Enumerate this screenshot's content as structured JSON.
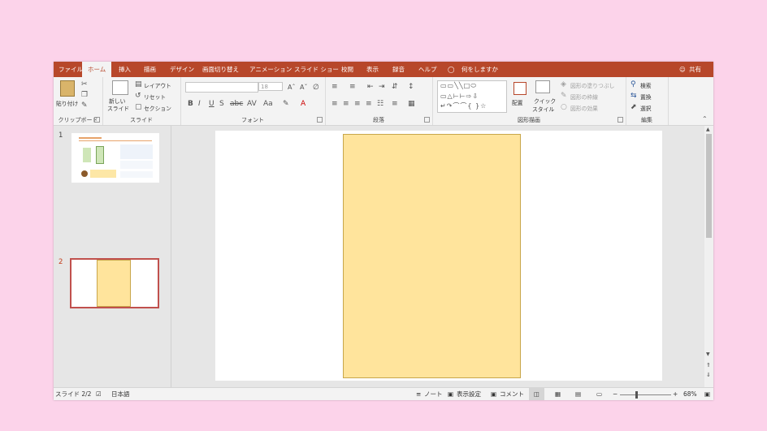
{
  "tabs": [
    "ファイル",
    "ホーム",
    "挿入",
    "描画",
    "デザイン",
    "画面切り替え",
    "アニメーション",
    "スライド ショー",
    "校閲",
    "表示",
    "録音",
    "ヘルプ"
  ],
  "tell_me": "何をしますか",
  "share": "共有",
  "clipboard": {
    "paste": "貼り付け",
    "label": "クリップボード"
  },
  "slides_group": {
    "new_slide_1": "新しい",
    "new_slide_2": "スライド",
    "layout": "レイアウト",
    "reset": "リセット",
    "section": "セクション",
    "label": "スライド"
  },
  "font": {
    "name": "",
    "size": "18",
    "label": "フォント"
  },
  "paragraph": {
    "label": "段落"
  },
  "drawing": {
    "arrange": "配置",
    "quick_style_1": "クイック",
    "quick_style_2": "スタイル",
    "fill": "図形の塗りつぶし",
    "outline": "図形の枠線",
    "effects": "図形の効果",
    "label": "図形描画"
  },
  "editing": {
    "find": "検索",
    "replace": "置換",
    "select": "選択",
    "label": "編集"
  },
  "thumbs": {
    "num1": "1",
    "num2": "2"
  },
  "status": {
    "slide": "スライド 2/2",
    "lang": "日本語",
    "notes": "ノート",
    "display": "表示設定",
    "comment": "コメント",
    "zoom": "68%"
  }
}
